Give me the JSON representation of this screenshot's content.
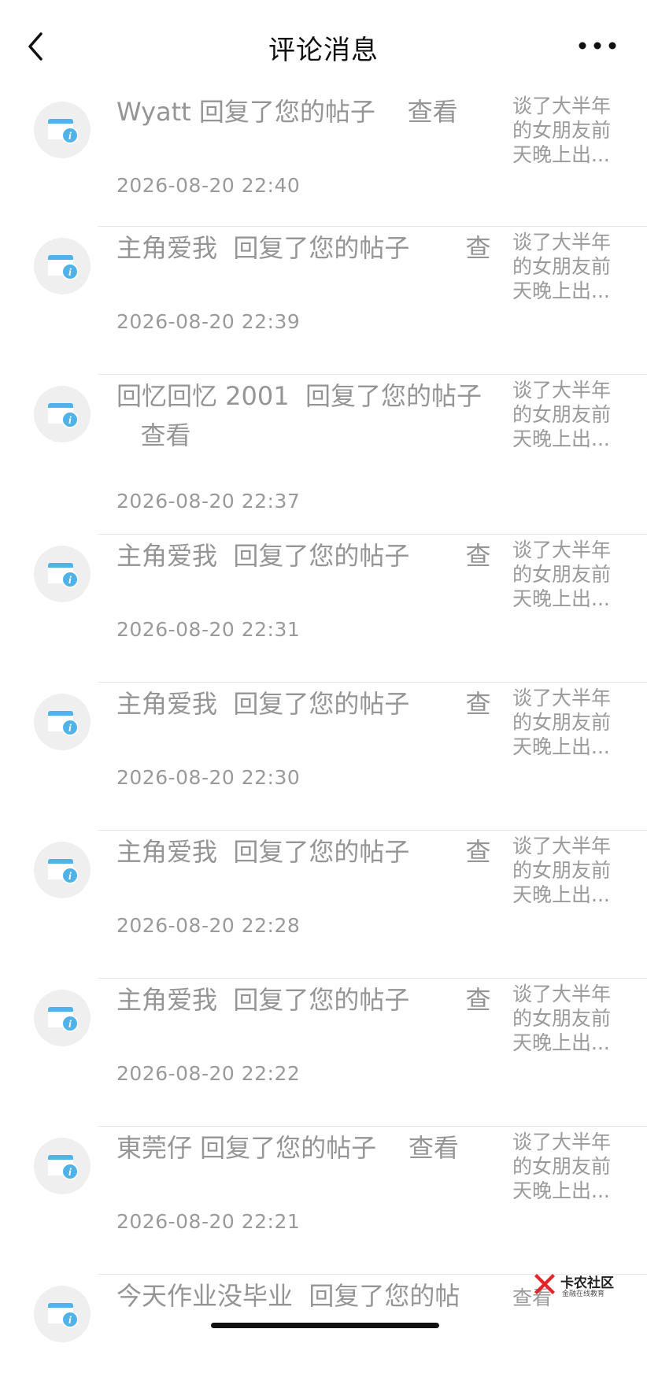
{
  "header": {
    "title": "评论消息",
    "back_icon": "chevron-left-icon",
    "more_icon": "more-dots-icon"
  },
  "items": [
    {
      "lines": [
        "Wyatt 回复了您的帖子    查看"
      ],
      "time": "2026-08-20 22:40",
      "preview": "谈了大半年\n的女朋友前\n天晚上出..."
    },
    {
      "lines": [
        "主角爱我  回复了您的帖子       查"
      ],
      "time": "2026-08-20 22:39",
      "preview": "谈了大半年\n的女朋友前\n天晚上出..."
    },
    {
      "lines": [
        "回忆回忆 2001  回复了您的帖子",
        "   查看"
      ],
      "time": "2026-08-20 22:37",
      "preview": "谈了大半年\n的女朋友前\n天晚上出..."
    },
    {
      "lines": [
        "主角爱我  回复了您的帖子       查"
      ],
      "time": "2026-08-20 22:31",
      "preview": "谈了大半年\n的女朋友前\n天晚上出..."
    },
    {
      "lines": [
        "主角爱我  回复了您的帖子       查"
      ],
      "time": "2026-08-20 22:30",
      "preview": "谈了大半年\n的女朋友前\n天晚上出..."
    },
    {
      "lines": [
        "主角爱我  回复了您的帖子       查"
      ],
      "time": "2026-08-20 22:28",
      "preview": "谈了大半年\n的女朋友前\n天晚上出..."
    },
    {
      "lines": [
        "主角爱我  回复了您的帖子       查"
      ],
      "time": "2026-08-20 22:22",
      "preview": "谈了大半年\n的女朋友前\n天晚上出..."
    },
    {
      "lines": [
        "東莞仔 回复了您的帖子    查看"
      ],
      "time": "2026-08-20 22:21",
      "preview": "谈了大半年\n的女朋友前\n天晚上出..."
    },
    {
      "lines": [
        "今天作业没毕业  回复了您的帖"
      ],
      "time": "",
      "preview": "查看"
    }
  ],
  "watermark": {
    "title": "卡农社区",
    "subtitle": "金融在线教育"
  },
  "colors": {
    "icon_blue": "#4fb3ea",
    "avatar_bg": "#efefef"
  }
}
